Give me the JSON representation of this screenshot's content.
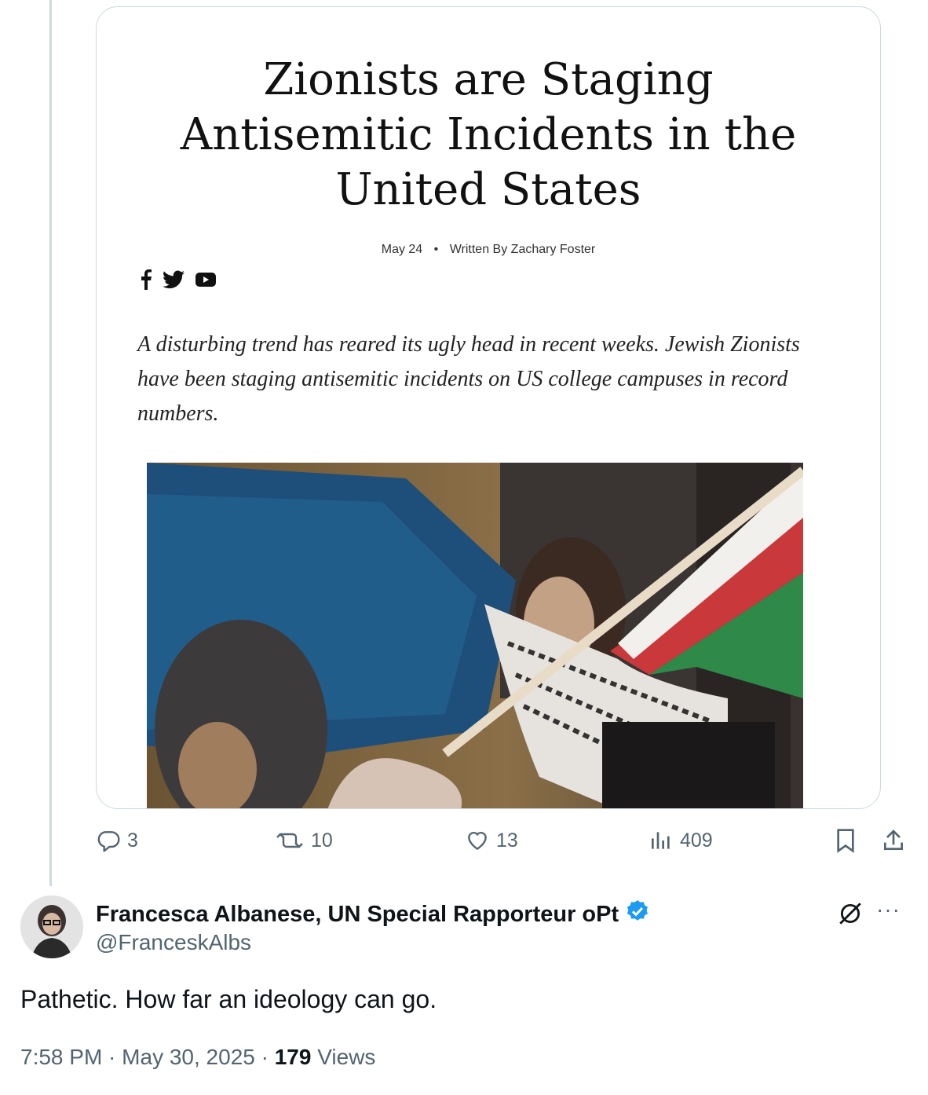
{
  "article": {
    "title_line1": "Zionists are Staging",
    "title_line2": "Antisemitic Incidents in the",
    "title_line3": "United States",
    "date": "May 24",
    "separator": "•",
    "byline": "Written By Zachary Foster",
    "lede": "A disturbing trend has reared its ugly head in recent weeks. Jewish Zionists have been staging antisemitic incidents on US college campuses in record numbers.",
    "social_icons": [
      "facebook-icon",
      "twitter-icon",
      "youtube-icon"
    ]
  },
  "actions": {
    "replies": "3",
    "reposts": "10",
    "likes": "13",
    "views": "409"
  },
  "author": {
    "name": "Francesca Albanese, UN Special Rapporteur oPt",
    "handle": "@FranceskAlbs",
    "verified": true
  },
  "tweet": {
    "text": "Pathetic. How far an ideology can go.",
    "time": "7:58 PM",
    "sep1": " · ",
    "date": "May 30, 2025",
    "sep2": " · ",
    "views_count": "179",
    "views_label": " Views"
  },
  "colors": {
    "muted": "#536471",
    "verified": "#1d9bf0",
    "border": "#cfd9de"
  }
}
